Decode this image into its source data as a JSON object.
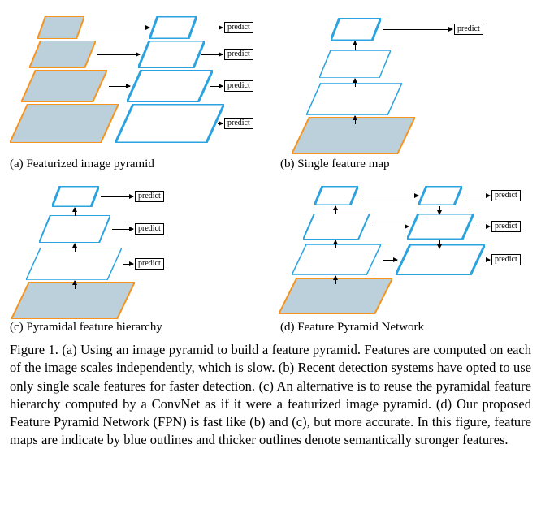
{
  "predict_label": "predict",
  "sub_captions": {
    "a": "(a) Featurized image pyramid",
    "b": "(b) Single feature map",
    "c": "(c) Pyramidal feature hierarchy",
    "d": "(d) Feature Pyramid Network"
  },
  "figure_caption": "Figure 1. (a) Using an image pyramid to build a feature pyramid. Features are computed on each of the image scales independently, which is slow. (b) Recent detection systems have opted to use only single scale features for faster detection. (c) An alternative is to reuse the pyramidal feature hierarchy computed by a ConvNet as if it were a featurized image pyramid. (d) Our proposed Feature Pyramid Network (FPN) is fast like (b) and (c), but more accurate. In this figure, feature maps are indicate by blue outlines and thicker outlines denote semantically stronger features."
}
